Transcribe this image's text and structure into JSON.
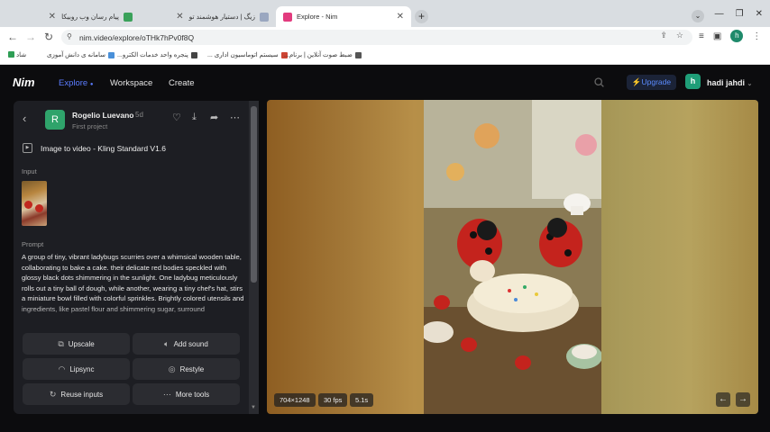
{
  "browser": {
    "tabs": [
      {
        "title": "پیام رسان وب روبیکا",
        "active": false
      },
      {
        "title": "زیگ | دستیار هوشمند تو",
        "active": false
      },
      {
        "title": "Explore - Nim",
        "active": true
      }
    ],
    "url": "nim.video/explore/oTHk7hPv0f8Q",
    "bookmarks": [
      "ضبط صوت آنلاین | برنام...",
      "سیستم اتوماسیون اداری ...",
      "پنجره واحد خدمات الکترو...",
      "سامانه ی دانش آموزی",
      "شاد"
    ],
    "profile_initial": "h"
  },
  "app": {
    "logo": "Nim",
    "nav": [
      {
        "label": "Explore",
        "active": true
      },
      {
        "label": "Workspace",
        "active": false
      },
      {
        "label": "Create",
        "active": false
      }
    ],
    "upgrade_label": "Upgrade",
    "user_initial": "h",
    "username": "hadi jahdi"
  },
  "panel": {
    "author_initial": "R",
    "author": "Rogelio Luevano",
    "time_ago": "5d",
    "project": "First project",
    "model": "Image to video - Kling Standard V1.6",
    "input_label": "Input",
    "prompt_label": "Prompt",
    "prompt_text": "A group of tiny, vibrant ladybugs scurries over a whimsical wooden table, collaborating to bake a cake. their delicate red bodies speckled with glossy black dots shimmering in the sunlight. One ladybug meticulously rolls out a tiny ball of dough, while another, wearing a tiny chef's hat, stirs a miniature bowl filled with colorful sprinkles. Brightly colored utensils and ingredients, like pastel flour and shimmering sugar, surround",
    "buttons": [
      {
        "label": "Upscale",
        "icon": "upscale-icon"
      },
      {
        "label": "Add sound",
        "icon": "speaker-icon"
      },
      {
        "label": "Lipsync",
        "icon": "lips-icon"
      },
      {
        "label": "Restyle",
        "icon": "palette-icon"
      },
      {
        "label": "Reuse inputs",
        "icon": "refresh-icon"
      },
      {
        "label": "More tools",
        "icon": "more-dots-icon"
      }
    ]
  },
  "video": {
    "resolution": "704×1248",
    "fps": "30 fps",
    "duration": "5.1s"
  },
  "colors": {
    "accent": "#5b7cff",
    "background": "#0c0c0e",
    "panel": "#1d1e23",
    "button": "#2b2c31",
    "avatar_green": "#1f9e78"
  }
}
